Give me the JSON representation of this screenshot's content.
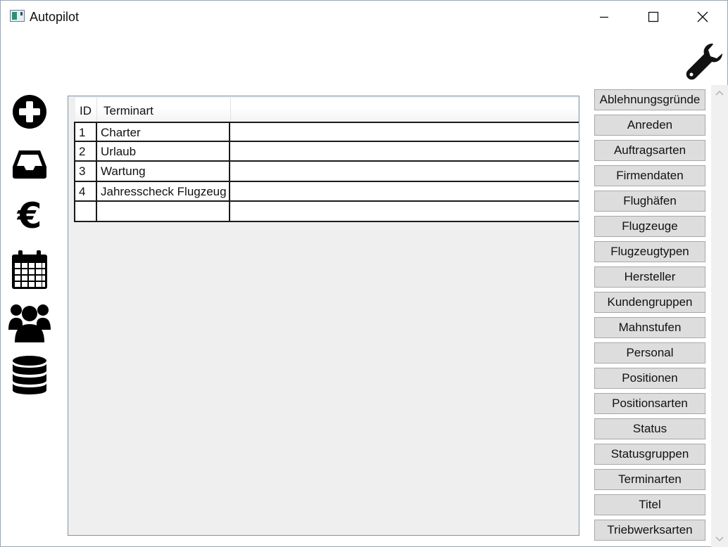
{
  "window": {
    "title": "Autopilot"
  },
  "left_nav": [
    {
      "name": "add-icon"
    },
    {
      "name": "inbox-icon"
    },
    {
      "name": "euro-icon",
      "glyph": "€"
    },
    {
      "name": "calendar-icon"
    },
    {
      "name": "users-icon"
    },
    {
      "name": "database-icon"
    }
  ],
  "grid": {
    "columns": [
      "ID",
      "Terminart"
    ],
    "rows": [
      {
        "id": "1",
        "terminart": "Charter"
      },
      {
        "id": "2",
        "terminart": "Urlaub"
      },
      {
        "id": "3",
        "terminart": "Wartung"
      },
      {
        "id": "4",
        "terminart": "Jahresscheck Flugzeug"
      },
      {
        "id": "",
        "terminart": ""
      }
    ]
  },
  "side_buttons": [
    "Ablehnungsgründe",
    "Anreden",
    "Auftragsarten",
    "Firmendaten",
    "Flughäfen",
    "Flugzeuge",
    "Flugzeugtypen",
    "Hersteller",
    "Kundengruppen",
    "Mahnstufen",
    "Personal",
    "Positionen",
    "Positionsarten",
    "Status",
    "Statusgruppen",
    "Terminarten",
    "Titel",
    "Triebwerksarten"
  ],
  "colors": {
    "panel_bg": "#efefef",
    "button_bg": "#dddddd",
    "panel_border": "#7e95ab"
  }
}
